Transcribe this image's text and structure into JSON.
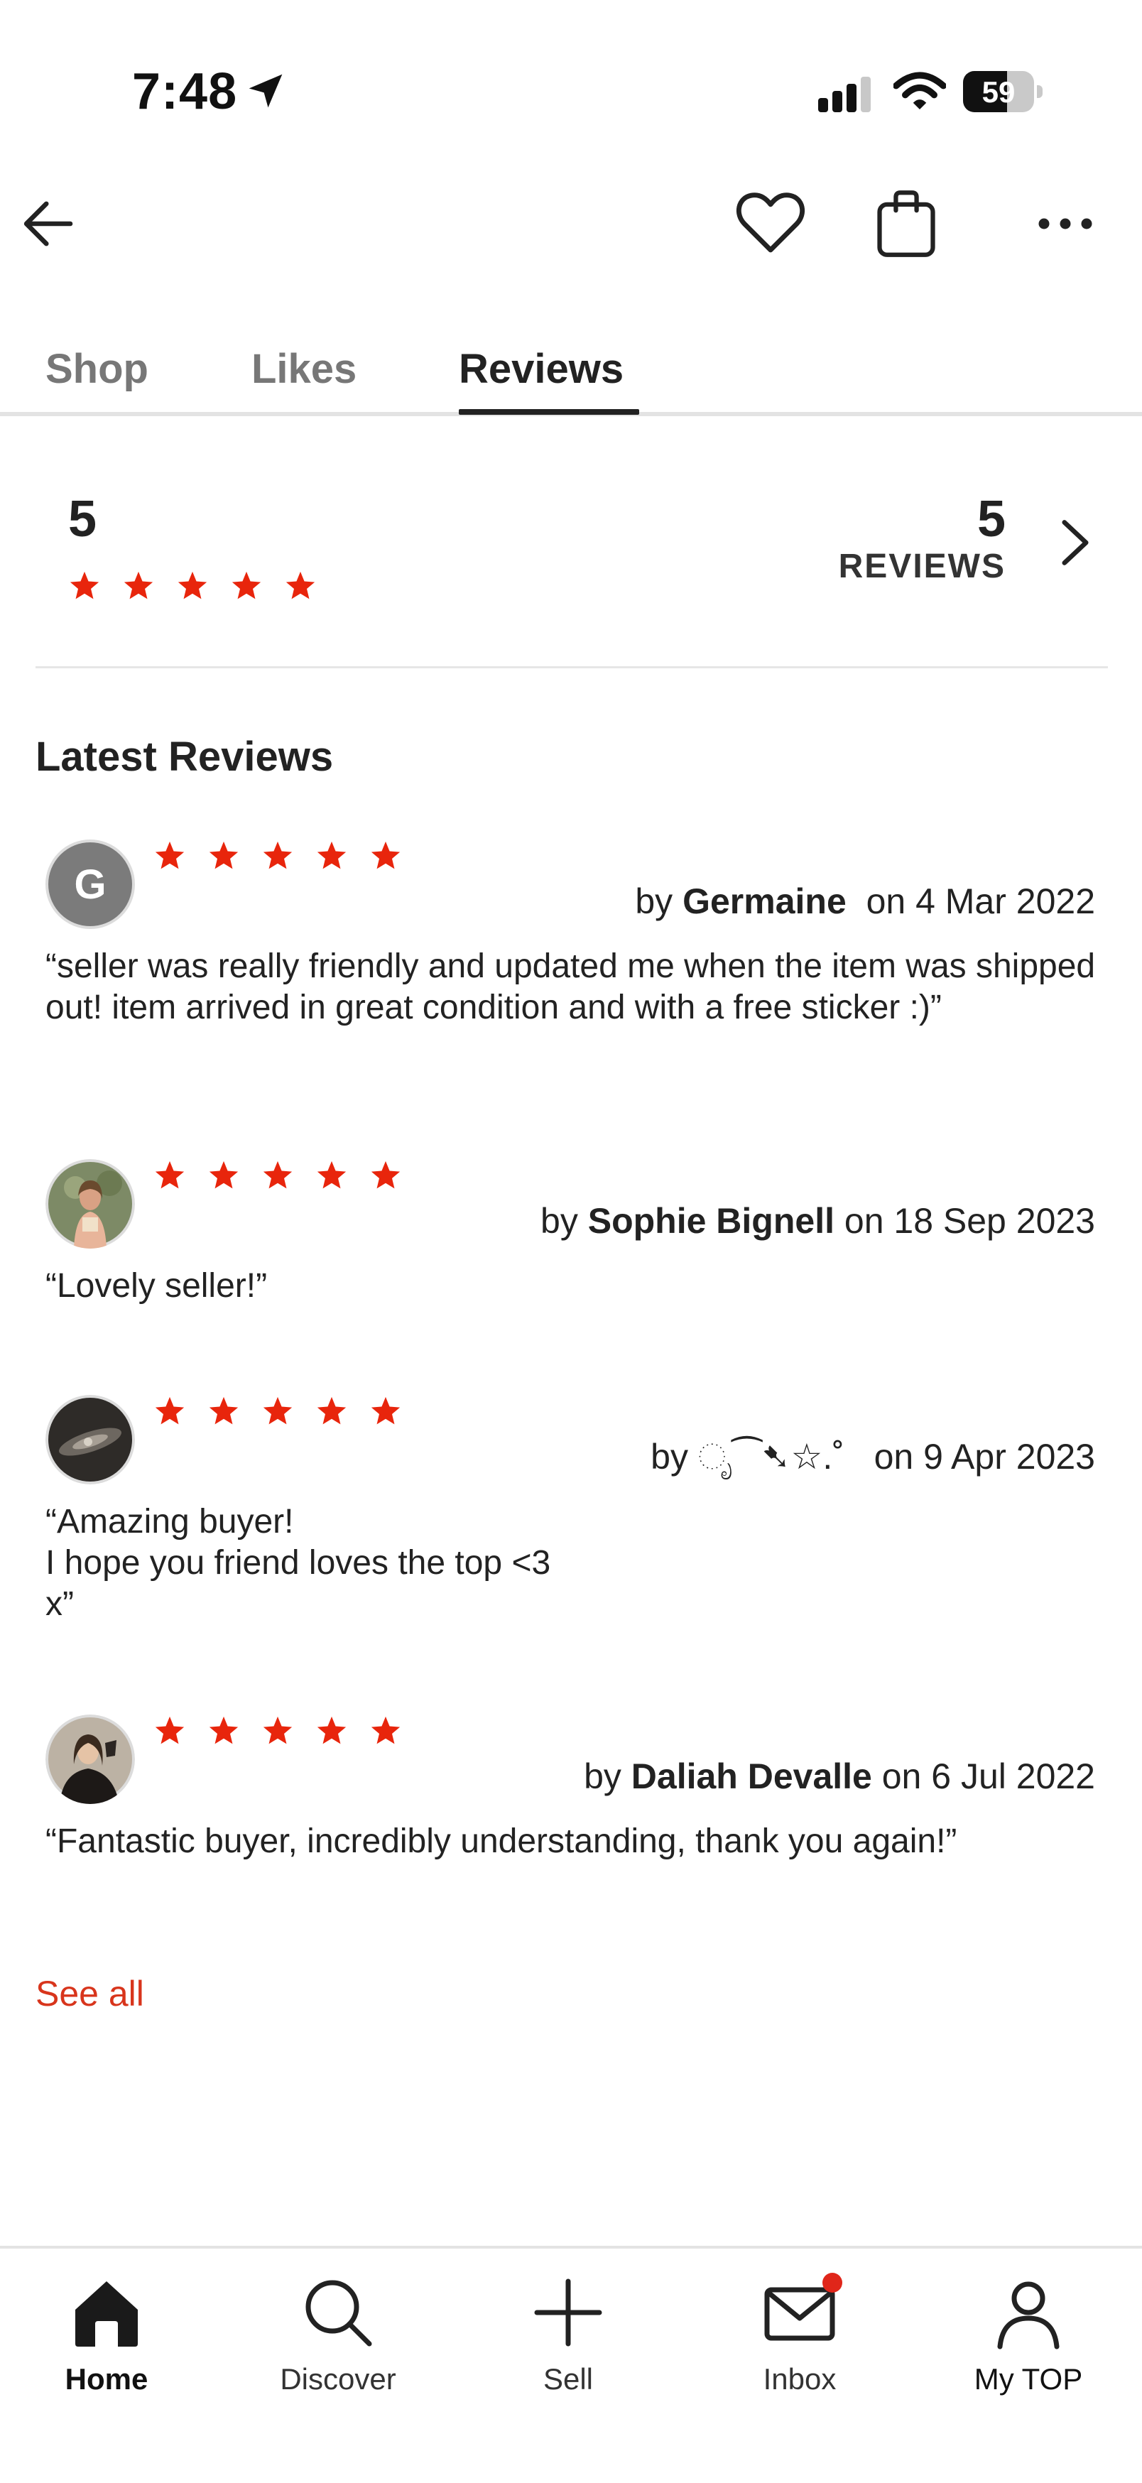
{
  "status_bar": {
    "time": "7:48",
    "battery": "59"
  },
  "tabs": [
    {
      "label": "Shop"
    },
    {
      "label": "Likes"
    },
    {
      "label": "Reviews"
    }
  ],
  "summary": {
    "average": "5",
    "star_rating": 5,
    "count": "5",
    "count_label": "REVIEWS"
  },
  "section_title": "Latest Reviews",
  "reviews": [
    {
      "by": "by",
      "name": "Germaine",
      "on": "on 4 Mar 2022",
      "avatar_letter": "G",
      "rating": 5,
      "text": "“seller was really friendly and updated me when the item was shipped out! item arrived in great condition and with a free sticker :)”"
    },
    {
      "by": "by",
      "name": "Sophie Bignell",
      "on": "on 18 Sep 2023",
      "rating": 5,
      "text": "“Lovely seller!”"
    },
    {
      "by": "by",
      "name": "ೃ⁀➷☆.˚",
      "on": "on 9 Apr 2023",
      "rating": 5,
      "text": "“Amazing buyer!\nI hope you friend loves the top <3\nx”"
    },
    {
      "by": "by",
      "name": "Daliah Devalle",
      "on": "on 6 Jul 2022",
      "rating": 5,
      "text": "“Fantastic buyer, incredibly understanding, thank you again!”"
    }
  ],
  "see_all": "See all",
  "bottom_nav": [
    {
      "label": "Home",
      "icon": "home-icon"
    },
    {
      "label": "Discover",
      "icon": "search-icon"
    },
    {
      "label": "Sell",
      "icon": "plus-icon"
    },
    {
      "label": "Inbox",
      "icon": "mail-icon"
    },
    {
      "label": "My TOP",
      "icon": "profile-icon"
    }
  ],
  "colors": {
    "accent": "#d8351c",
    "star": "#e8250c",
    "text": "#222222",
    "muted": "#777777"
  }
}
